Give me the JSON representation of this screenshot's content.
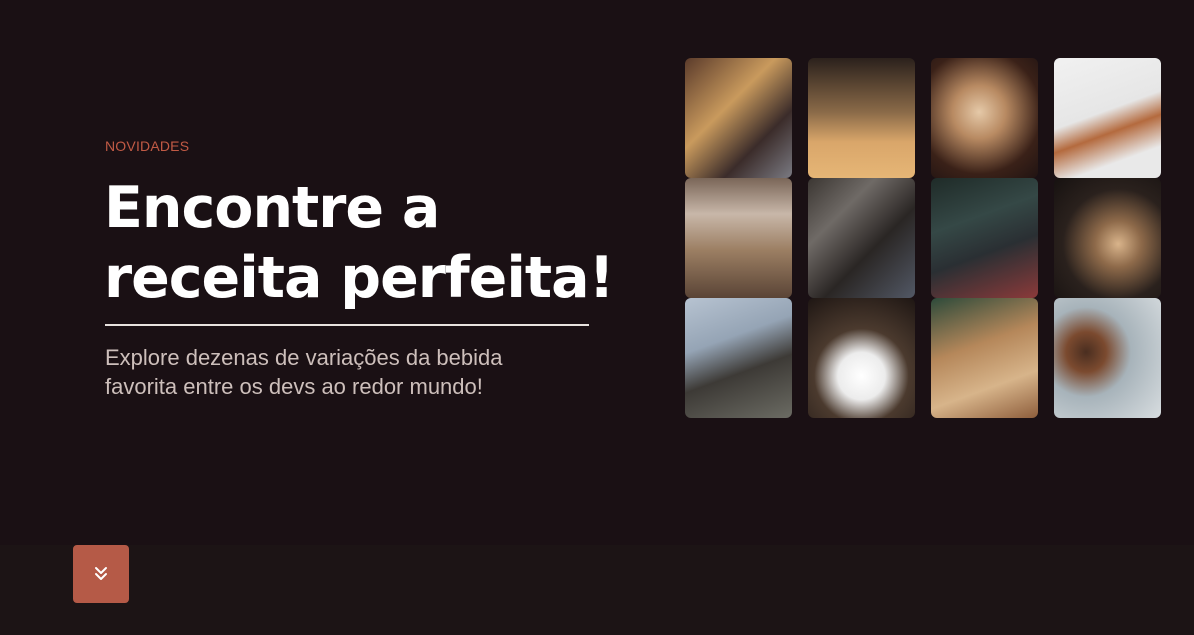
{
  "hero": {
    "eyebrow": "NOVIDADES",
    "headline": "Encontre a receita perfeita!",
    "subtitle": "Explore dezenas de variações da bebida favorita entre os devs ao redor mundo!"
  },
  "gallery": {
    "tiles": [
      {
        "icon": "photo-laptop-on-wooden-desk"
      },
      {
        "icon": "photo-pouring-coffee-glass"
      },
      {
        "icon": "photo-woman-drinking-coffee"
      },
      {
        "icon": "photo-pouring-coffee-stream"
      },
      {
        "icon": "photo-cup-on-table-blur"
      },
      {
        "icon": "photo-people-at-espresso-machine"
      },
      {
        "icon": "photo-developer-at-monitors"
      },
      {
        "icon": "photo-latte-art-pour"
      },
      {
        "icon": "photo-person-with-coffee-cup-laptop"
      },
      {
        "icon": "photo-coffee-dripping-into-cup"
      },
      {
        "icon": "photo-desk-with-notebook-and-coffee"
      },
      {
        "icon": "photo-coffee-beans-and-latte"
      }
    ]
  },
  "scroll_button": {
    "icon": "double-chevron-down-icon"
  },
  "colors": {
    "background": "#1a1014",
    "accent": "#b55a47",
    "eyebrow": "#c15a45",
    "headline": "#ffffff",
    "subtitle": "#cdbfbb"
  }
}
